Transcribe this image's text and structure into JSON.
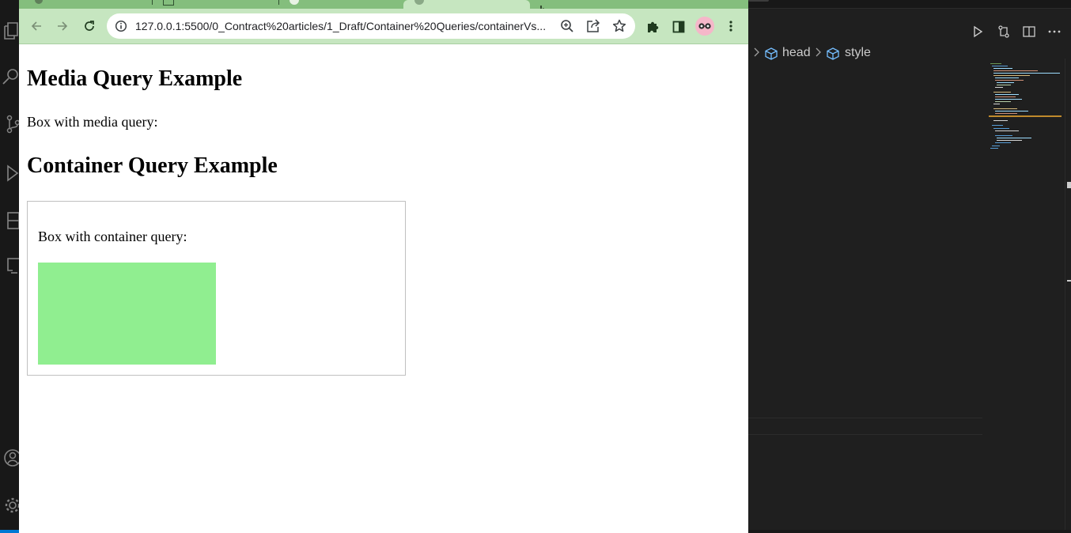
{
  "browser": {
    "url": "127.0.0.1:5500/0_Contract%20articles/1_Draft/Container%20Queries/containerVs...",
    "theme": {
      "frame": "#84be7d",
      "toolbar": "#c6e6c0"
    },
    "icons": {
      "back": "arrow-left-icon",
      "forward": "arrow-right-icon",
      "reload": "reload-icon",
      "info": "info-icon",
      "zoom": "zoom-icon",
      "share": "share-icon",
      "bookmark": "star-icon",
      "extensions": "puzzle-icon",
      "side_panel": "side-panel-icon",
      "profile": "profile-avatar",
      "menu": "kebab-menu-icon"
    }
  },
  "page": {
    "media_heading": "Media Query Example",
    "media_text": "Box with media query:",
    "container_heading": "Container Query Example",
    "container_text": "Box with container query:",
    "green_box_color": "#90ee90"
  },
  "vscode": {
    "breadcrumbs": [
      "head",
      "style"
    ],
    "actions": [
      "run-icon",
      "compare-changes-icon",
      "split-editor-icon",
      "more-actions-icon"
    ],
    "accent": "#0078d4"
  }
}
